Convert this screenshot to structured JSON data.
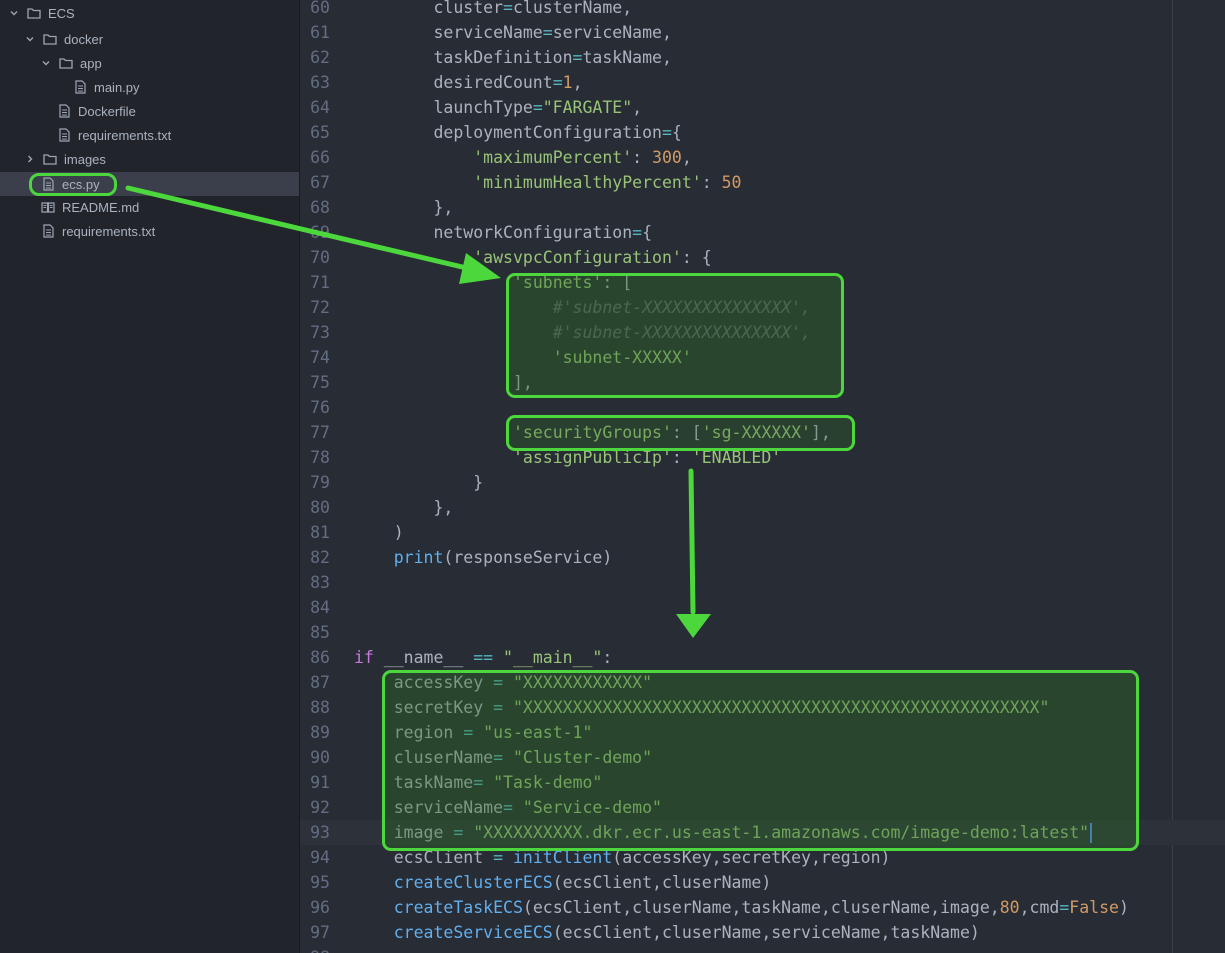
{
  "sidebar": {
    "items": [
      {
        "label": "ECS",
        "icon": "folder-icon",
        "chevron": "down"
      },
      {
        "label": "docker",
        "icon": "folder-icon",
        "chevron": "down"
      },
      {
        "label": "app",
        "icon": "folder-icon",
        "chevron": "down"
      },
      {
        "label": "main.py",
        "icon": "file-icon",
        "chevron": ""
      },
      {
        "label": "Dockerfile",
        "icon": "file-icon",
        "chevron": ""
      },
      {
        "label": "requirements.txt",
        "icon": "file-icon",
        "chevron": ""
      },
      {
        "label": "images",
        "icon": "folder-icon",
        "chevron": "right"
      },
      {
        "label": "ecs.py",
        "icon": "file-icon",
        "chevron": "",
        "selected": true
      },
      {
        "label": "README.md",
        "icon": "book-icon",
        "chevron": ""
      },
      {
        "label": "requirements.txt",
        "icon": "file-icon",
        "chevron": ""
      }
    ]
  },
  "editor": {
    "cursor_line": "93",
    "lines": [
      {
        "num": "60",
        "tokens": [
          [
            "",
            "        cluster"
          ],
          [
            "o",
            "="
          ],
          [
            "",
            "clusterName,"
          ]
        ]
      },
      {
        "num": "61",
        "tokens": [
          [
            "",
            "        serviceName"
          ],
          [
            "o",
            "="
          ],
          [
            "",
            "serviceName,"
          ]
        ]
      },
      {
        "num": "62",
        "tokens": [
          [
            "",
            "        taskDefinition"
          ],
          [
            "o",
            "="
          ],
          [
            "",
            "taskName,"
          ]
        ]
      },
      {
        "num": "63",
        "tokens": [
          [
            "",
            "        desiredCount"
          ],
          [
            "o",
            "="
          ],
          [
            "n",
            "1"
          ],
          [
            "",
            ","
          ]
        ]
      },
      {
        "num": "64",
        "tokens": [
          [
            "",
            "        launchType"
          ],
          [
            "o",
            "="
          ],
          [
            "s",
            "\"FARGATE\""
          ],
          [
            "",
            ","
          ]
        ]
      },
      {
        "num": "65",
        "tokens": [
          [
            "",
            "        deploymentConfiguration"
          ],
          [
            "o",
            "="
          ],
          [
            "",
            "{"
          ]
        ]
      },
      {
        "num": "66",
        "tokens": [
          [
            "",
            "            "
          ],
          [
            "s",
            "'maximumPercent'"
          ],
          [
            "",
            ": "
          ],
          [
            "n",
            "300"
          ],
          [
            "",
            ","
          ]
        ]
      },
      {
        "num": "67",
        "tokens": [
          [
            "",
            "            "
          ],
          [
            "s",
            "'minimumHealthyPercent'"
          ],
          [
            "",
            ": "
          ],
          [
            "n",
            "50"
          ]
        ]
      },
      {
        "num": "68",
        "tokens": [
          [
            "",
            "        },"
          ]
        ]
      },
      {
        "num": "69",
        "tokens": [
          [
            "",
            "        networkConfiguration"
          ],
          [
            "o",
            "="
          ],
          [
            "",
            "{"
          ]
        ]
      },
      {
        "num": "70",
        "tokens": [
          [
            "",
            "            "
          ],
          [
            "s",
            "'awsvpcConfiguration'"
          ],
          [
            "",
            ": {"
          ]
        ]
      },
      {
        "num": "71",
        "tokens": [
          [
            "",
            "                "
          ],
          [
            "s",
            "'subnets'"
          ],
          [
            "",
            ": ["
          ]
        ]
      },
      {
        "num": "72",
        "tokens": [
          [
            "",
            "                    "
          ],
          [
            "c",
            "#'subnet-XXXXXXXXXXXXXXX',"
          ]
        ]
      },
      {
        "num": "73",
        "tokens": [
          [
            "",
            "                    "
          ],
          [
            "c",
            "#'subnet-XXXXXXXXXXXXXXX',"
          ]
        ]
      },
      {
        "num": "74",
        "tokens": [
          [
            "",
            "                    "
          ],
          [
            "s",
            "'subnet-XXXXX'"
          ]
        ]
      },
      {
        "num": "75",
        "tokens": [
          [
            "",
            "                ],"
          ]
        ]
      },
      {
        "num": "76",
        "tokens": [
          [
            "",
            ""
          ]
        ]
      },
      {
        "num": "77",
        "tokens": [
          [
            "",
            "                "
          ],
          [
            "s",
            "'securityGroups'"
          ],
          [
            "",
            ": ["
          ],
          [
            "s",
            "'sg-XXXXXX'"
          ],
          [
            "",
            "],"
          ]
        ]
      },
      {
        "num": "78",
        "tokens": [
          [
            "",
            "                "
          ],
          [
            "s",
            "'assignPublicIp'"
          ],
          [
            "",
            ": "
          ],
          [
            "s",
            "'ENABLED'"
          ]
        ]
      },
      {
        "num": "79",
        "tokens": [
          [
            "",
            "            }"
          ]
        ]
      },
      {
        "num": "80",
        "tokens": [
          [
            "",
            "        },"
          ]
        ]
      },
      {
        "num": "81",
        "tokens": [
          [
            "",
            "    )"
          ]
        ]
      },
      {
        "num": "82",
        "tokens": [
          [
            "",
            "    "
          ],
          [
            "f",
            "print"
          ],
          [
            "",
            "(responseService)"
          ]
        ]
      },
      {
        "num": "83",
        "tokens": [
          [
            "",
            ""
          ]
        ]
      },
      {
        "num": "84",
        "tokens": [
          [
            "",
            ""
          ]
        ]
      },
      {
        "num": "85",
        "tokens": [
          [
            "",
            ""
          ]
        ]
      },
      {
        "num": "86",
        "tokens": [
          [
            "k",
            "if"
          ],
          [
            "",
            " __name__ "
          ],
          [
            "o",
            "=="
          ],
          [
            "",
            " "
          ],
          [
            "s",
            "\"__main__\""
          ],
          [
            "",
            ":"
          ]
        ]
      },
      {
        "num": "87",
        "tokens": [
          [
            "",
            "    accessKey "
          ],
          [
            "o",
            "="
          ],
          [
            "",
            " "
          ],
          [
            "s",
            "\"XXXXXXXXXXXX\""
          ]
        ]
      },
      {
        "num": "88",
        "tokens": [
          [
            "",
            "    secretKey "
          ],
          [
            "o",
            "="
          ],
          [
            "",
            " "
          ],
          [
            "s",
            "\"XXXXXXXXXXXXXXXXXXXXXXXXXXXXXXXXXXXXXXXXXXXXXXXXXXXX\""
          ]
        ]
      },
      {
        "num": "89",
        "tokens": [
          [
            "",
            "    region "
          ],
          [
            "o",
            "="
          ],
          [
            "",
            " "
          ],
          [
            "s",
            "\"us-east-1\""
          ]
        ]
      },
      {
        "num": "90",
        "tokens": [
          [
            "",
            "    cluserName"
          ],
          [
            "o",
            "="
          ],
          [
            "",
            " "
          ],
          [
            "s",
            "\"Cluster-demo\""
          ]
        ]
      },
      {
        "num": "91",
        "tokens": [
          [
            "",
            "    taskName"
          ],
          [
            "o",
            "="
          ],
          [
            "",
            " "
          ],
          [
            "s",
            "\"Task-demo\""
          ]
        ]
      },
      {
        "num": "92",
        "tokens": [
          [
            "",
            "    serviceName"
          ],
          [
            "o",
            "="
          ],
          [
            "",
            " "
          ],
          [
            "s",
            "\"Service-demo\""
          ]
        ]
      },
      {
        "num": "93",
        "tokens": [
          [
            "",
            "    image "
          ],
          [
            "o",
            "="
          ],
          [
            "",
            " "
          ],
          [
            "s",
            "\"XXXXXXXXXX.dkr.ecr.us-east-1.amazonaws.com/image-demo:latest\""
          ]
        ]
      },
      {
        "num": "94",
        "tokens": [
          [
            "",
            "    ecsClient "
          ],
          [
            "o",
            "="
          ],
          [
            "",
            " "
          ],
          [
            "f",
            "initClient"
          ],
          [
            "",
            "(accessKey,secretKey,region)"
          ]
        ]
      },
      {
        "num": "95",
        "tokens": [
          [
            "",
            "    "
          ],
          [
            "f",
            "createClusterECS"
          ],
          [
            "",
            "(ecsClient,cluserName)"
          ]
        ]
      },
      {
        "num": "96",
        "tokens": [
          [
            "",
            "    "
          ],
          [
            "f",
            "createTaskECS"
          ],
          [
            "",
            "(ecsClient,cluserName,taskName,cluserName,image,"
          ],
          [
            "n",
            "80"
          ],
          [
            "",
            ","
          ],
          [
            "",
            "cmd"
          ],
          [
            "o",
            "="
          ],
          [
            "n",
            "False"
          ],
          [
            "",
            ")"
          ]
        ]
      },
      {
        "num": "97",
        "tokens": [
          [
            "",
            "    "
          ],
          [
            "f",
            "createServiceECS"
          ],
          [
            "",
            "(ecsClient,cluserName,serviceName,taskName)"
          ]
        ]
      },
      {
        "num": "98",
        "tokens": [
          [
            "",
            ""
          ]
        ]
      }
    ]
  },
  "annotations": {
    "color": "#4cd83c",
    "fill": "#2e6e26"
  }
}
